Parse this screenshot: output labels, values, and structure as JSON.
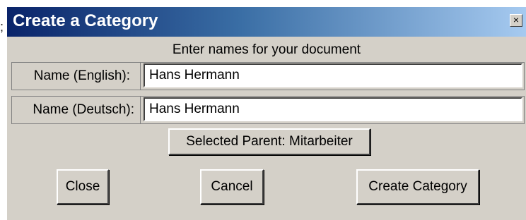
{
  "stray_mark": ";",
  "dialog": {
    "title": "Create a Category",
    "close_glyph": "×",
    "instructions": "Enter names for your document",
    "fields": [
      {
        "label": "Name (English):",
        "value": "Hans Hermann"
      },
      {
        "label": "Name (Deutsch):",
        "value": "Hans Hermann"
      }
    ],
    "selected_parent": "Selected Parent:  Mitarbeiter",
    "buttons": {
      "close": "Close",
      "cancel": "Cancel",
      "create": "Create Category"
    }
  },
  "colors": {
    "title_gradient_start": "#0a246a",
    "title_gradient_end": "#a6caf0",
    "dialog_face": "#d4d0c8"
  }
}
